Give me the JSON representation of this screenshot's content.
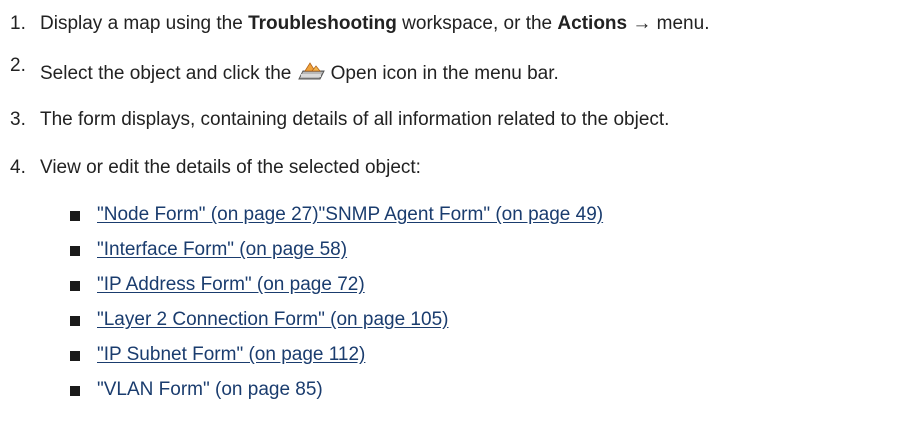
{
  "steps": [
    {
      "num": "1.",
      "pre": "Display a map using the ",
      "bold1": "Troubleshooting",
      "mid": " workspace, or the ",
      "bold2": "Actions",
      "post": " → menu."
    },
    {
      "num": "2.",
      "pre": "Select the object and click the ",
      "icon": "open-icon",
      "post": "Open icon in the menu bar."
    },
    {
      "num": "3.",
      "text": "The form displays, containing details of all information related to the object."
    },
    {
      "num": "4.",
      "text": "View or edit the details of the selected object:"
    }
  ],
  "links": [
    "\"Node Form\" (on page 27)\"SNMP Agent Form\" (on page 49)",
    "\"Interface Form\" (on page 58)",
    "\"IP Address Form\" (on page 72)",
    "\"Layer 2 Connection Form\" (on page 105)",
    "\"IP Subnet Form\" (on page 112)",
    "\"VLAN Form\" (on page 85)"
  ],
  "colors": {
    "text": "#222222",
    "link": "#1a3c6e",
    "bullet": "#1a1a1a"
  }
}
